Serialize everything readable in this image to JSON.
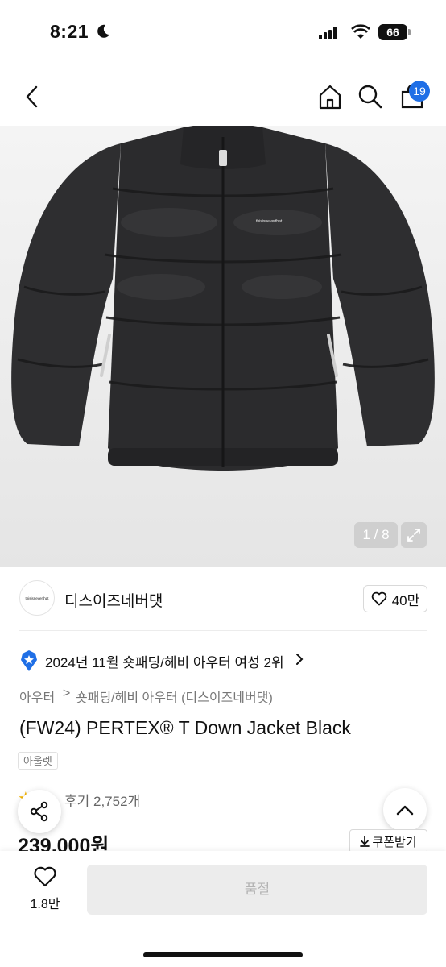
{
  "status_bar": {
    "time": "8:21",
    "battery": "66"
  },
  "header": {
    "cart_count": "19"
  },
  "gallery": {
    "counter": "1 / 8",
    "print_text": "thisisneverthat"
  },
  "brand": {
    "logo_text": "thisisneverthat",
    "name": "디스이즈네버댓",
    "likes": "40만"
  },
  "ranking": {
    "text": "2024년 11월 숏패딩/헤비 아우터 여성 2위"
  },
  "breadcrumb": {
    "level1": "아우터",
    "separator": ">",
    "level2": "숏패딩/헤비 아우터 (디스이즈네버댓)"
  },
  "product": {
    "title": "(FW24) PERTEX® T Down Jacket Black",
    "tag": "아울렛",
    "reviews": "후기 2,752개",
    "price": "239,000원",
    "coupon_label": "쿠폰받기"
  },
  "bottom_bar": {
    "like_count": "1.8만",
    "buy_label": "품절"
  },
  "colors": {
    "accent": "#1f6fe6",
    "star": "#f5b400",
    "jacket": "#2b2b2d"
  }
}
